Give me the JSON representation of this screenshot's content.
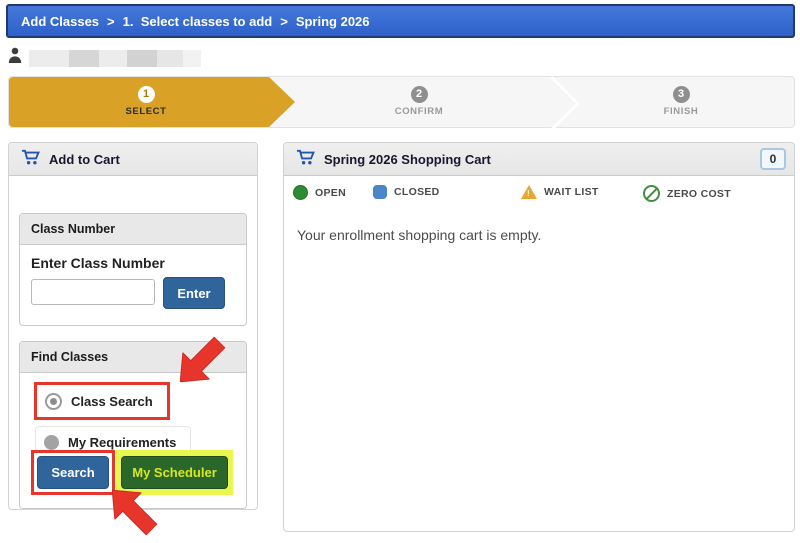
{
  "breadcrumb": {
    "items": [
      "Add Classes",
      "1.  Select classes to add",
      "Spring 2026"
    ],
    "separator": ">"
  },
  "stepper": {
    "steps": [
      {
        "num": "1",
        "label": "SELECT"
      },
      {
        "num": "2",
        "label": "CONFIRM"
      },
      {
        "num": "3",
        "label": "FINISH"
      }
    ]
  },
  "add_to_cart": {
    "title": "Add to Cart",
    "class_number": {
      "title": "Class Number",
      "label": "Enter Class Number",
      "input_value": "",
      "enter_button": "Enter"
    },
    "find_classes": {
      "title": "Find Classes",
      "options": [
        {
          "label": "Class Search",
          "selected": true
        },
        {
          "label": "My Requirements",
          "selected": false
        }
      ],
      "search_button": "Search",
      "scheduler_button": "My Scheduler"
    }
  },
  "shopping_cart": {
    "title": "Spring 2026 Shopping Cart",
    "count": "0",
    "legend": [
      {
        "icon": "open-status-icon",
        "label": "OPEN"
      },
      {
        "icon": "closed-status-icon",
        "label": "CLOSED"
      },
      {
        "icon": "waitlist-status-icon",
        "label": "WAIT LIST"
      },
      {
        "icon": "zero-cost-status-icon",
        "label": "ZERO COST"
      }
    ],
    "empty_message": "Your enrollment shopping cart is empty."
  },
  "icons": {
    "waitlist_glyph": "!"
  },
  "colors": {
    "header_blue": "#2e61c9",
    "step_active_gold": "#d9a226",
    "button_blue": "#30659c",
    "scheduler_green": "#2b672b",
    "scheduler_text_yellow": "#d8e722",
    "highlight_yellow": "#eaf650",
    "annotation_red": "#e8352b",
    "open_green": "#2e8b33",
    "closed_blue": "#4a85c7",
    "waitlist_amber": "#e7a62f",
    "zero_cost_green": "#3f8f3f"
  }
}
